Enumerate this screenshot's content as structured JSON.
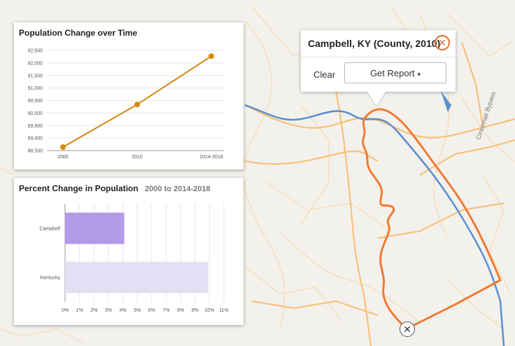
{
  "map": {
    "road_label": "Cincinnati Bypass",
    "colors": {
      "background": "#f3f1ec",
      "road": "#f7c27a",
      "river": "#5a8fcf",
      "boundary": "#ef7b35"
    }
  },
  "popup": {
    "title": "Campbell, KY (County, 2010)",
    "clear_label": "Clear",
    "report_label": "Get Report",
    "caret": "▾",
    "close_glyph": "✕"
  },
  "map_close_glyph": "✕",
  "line_card": {
    "title": "Population Change over Time"
  },
  "bar_card": {
    "title": "Percent Change in Population",
    "subtitle": "2000 to 2014-2018"
  },
  "chart_data": [
    {
      "type": "line",
      "title": "Population Change over Time",
      "x": [
        "2000",
        "2010",
        "2014-2018"
      ],
      "series": [
        {
          "values": [
            88640,
            90340,
            92270
          ],
          "color": "#d4880c"
        }
      ],
      "ylim": [
        88500,
        92500
      ],
      "yticks": [
        "88,500",
        "89,000",
        "89,500",
        "90,000",
        "90,500",
        "91,000",
        "91,500",
        "92,000",
        "92,500"
      ],
      "grid": true
    },
    {
      "type": "bar",
      "orientation": "horizontal",
      "title": "Percent Change in Population",
      "subtitle": "2000 to 2014-2018",
      "categories": [
        "Campbell",
        "Kentucky"
      ],
      "values": [
        4.1,
        9.9
      ],
      "colors": [
        "#b39ae8",
        "#e3dff4"
      ],
      "xlim": [
        0,
        11
      ],
      "xticks": [
        "0%",
        "1%",
        "2%",
        "3%",
        "4%",
        "5%",
        "6%",
        "7%",
        "8%",
        "9%",
        "10%",
        "11%"
      ],
      "grid": true
    }
  ]
}
